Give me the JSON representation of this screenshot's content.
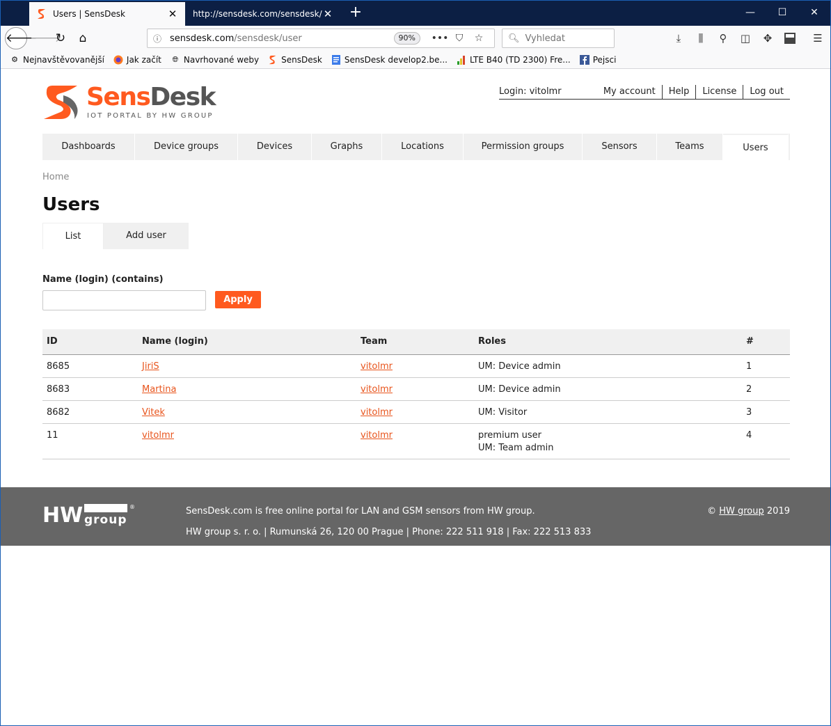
{
  "browser": {
    "tabs": [
      {
        "title": "Users | SensDesk",
        "active": true
      },
      {
        "title": "http://sensdesk.com/sensdesk/tea",
        "active": false
      }
    ],
    "url_host": "sensdesk.com",
    "url_path": "/sensdesk/user",
    "zoom": "90%",
    "search_placeholder": "Vyhledat",
    "bookmarks": [
      {
        "label": "Nejnavštěvovanější",
        "icon": "gear-icon"
      },
      {
        "label": "Jak začít",
        "icon": "firefox-icon"
      },
      {
        "label": "Navrhované weby",
        "icon": "globe-icon"
      },
      {
        "label": "SensDesk",
        "icon": "sensdesk-icon"
      },
      {
        "label": "SensDesk develop2.be...",
        "icon": "document-icon"
      },
      {
        "label": "LTE B40 (TD 2300) Fre...",
        "icon": "signal-icon"
      },
      {
        "label": "Pejsci",
        "icon": "facebook-icon"
      }
    ]
  },
  "header": {
    "logo_word_1": "Sens",
    "logo_word_2": "Desk",
    "logo_tagline": "IOT PORTAL BY HW GROUP",
    "login_label": "Login: vitolmr",
    "links": [
      "My account",
      "Help",
      "License",
      "Log out"
    ]
  },
  "nav": {
    "items": [
      "Dashboards",
      "Device groups",
      "Devices",
      "Graphs",
      "Locations",
      "Permission groups",
      "Sensors",
      "Teams",
      "Users"
    ],
    "active": "Users"
  },
  "breadcrumb": "Home",
  "page_title": "Users",
  "subtabs": [
    "List",
    "Add user"
  ],
  "filter": {
    "label": "Name (login) (contains)",
    "value": "",
    "apply_label": "Apply"
  },
  "table": {
    "headers": [
      "ID",
      "Name (login)",
      "Team",
      "Roles",
      "#"
    ],
    "rows": [
      {
        "id": "8685",
        "name": "JiriS",
        "team": "vitolmr",
        "roles": [
          "UM: Device admin"
        ],
        "num": "1"
      },
      {
        "id": "8683",
        "name": "Martina",
        "team": "vitolmr",
        "roles": [
          "UM: Device admin"
        ],
        "num": "2"
      },
      {
        "id": "8682",
        "name": "Vitek",
        "team": "vitolmr",
        "roles": [
          "UM: Visitor"
        ],
        "num": "3"
      },
      {
        "id": "11",
        "name": "vitolmr",
        "team": "vitolmr",
        "roles": [
          "premium user",
          "UM: Team admin"
        ],
        "num": "4"
      }
    ]
  },
  "footer": {
    "line1": "SensDesk.com is free online portal for LAN and GSM sensors from HW group.",
    "line2": "HW group s. r. o. | Rumunská 26, 120 00 Prague | Phone: 222 511 918 | Fax: 222 513 833",
    "copyright_symbol": "©",
    "copyright_link": "HW group",
    "copyright_year": "2019",
    "logo_text_1": "HW",
    "logo_text_2": "group",
    "logo_mark": "®"
  },
  "colors": {
    "accent": "#ff5a1f",
    "link": "#e8541c",
    "footer_bg": "#666666",
    "tabbar_bg": "#0c1f44"
  }
}
